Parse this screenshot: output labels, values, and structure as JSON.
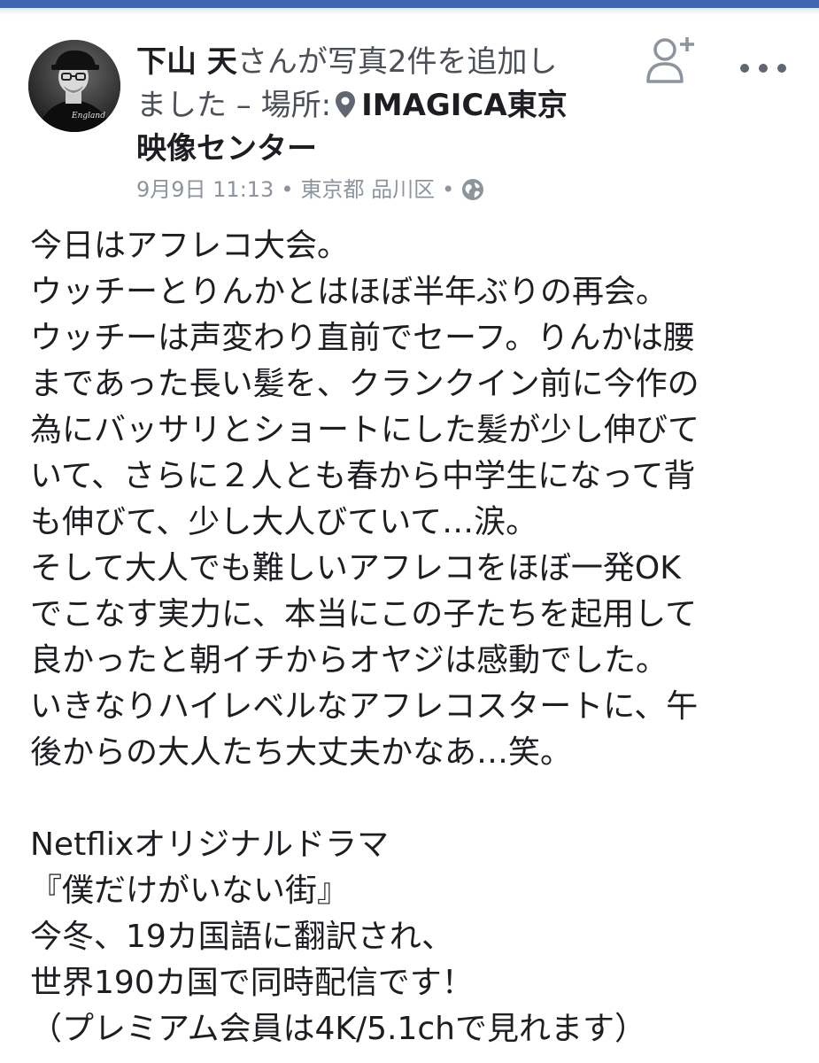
{
  "post": {
    "author": "下山 天",
    "header_action": "さんが写真2件を追加しました – 場所:",
    "location": "IMAGICA東京映像センター",
    "header_lines": {
      "line1_author": "下山 天",
      "line1_rest": "さんが写真2件を追加し",
      "line2_rest": "ました – 場所:",
      "line2_place": "IMAGICA東京",
      "line3_place": "映像センター"
    },
    "timestamp": "9月9日 11:13",
    "place_detail": "東京都 品川区",
    "separator": "•",
    "privacy_icon": "globe-icon",
    "body_lines": [
      "今日はアフレコ大会。",
      "ウッチーとりんかとはほぼ半年ぶりの再会。",
      "ウッチーは声変わり直前でセーフ。りんかは腰",
      "まであった長い髪を、クランクイン前に今作の",
      "為にバッサリとショートにした髪が少し伸びて",
      "いて、さらに２人とも春から中学生になって背",
      "も伸びて、少し大人びていて…涙。",
      "そして大人でも難しいアフレコをほぼ一発OK",
      "でこなす実力に、本当にこの子たちを起用して",
      "良かったと朝イチからオヤジは感動でした。",
      "いきなりハイレベルなアフレコスタートに、午",
      "後からの大人たち大丈夫かなあ…笑。",
      "",
      "Netflixオリジナルドラマ",
      "『僕だけがいない街』",
      "今冬、19カ国語に翻訳され、",
      "世界190カ国で同時配信です！",
      "（プレミアム会員は4K/5.1chで見れます）"
    ]
  },
  "actions": {
    "add_friend_icon": "add-friend-icon",
    "more_icon": "more-options-icon"
  },
  "colors": {
    "brand": "#4267b2",
    "text": "#1c1e21",
    "meta": "#8d949e"
  }
}
